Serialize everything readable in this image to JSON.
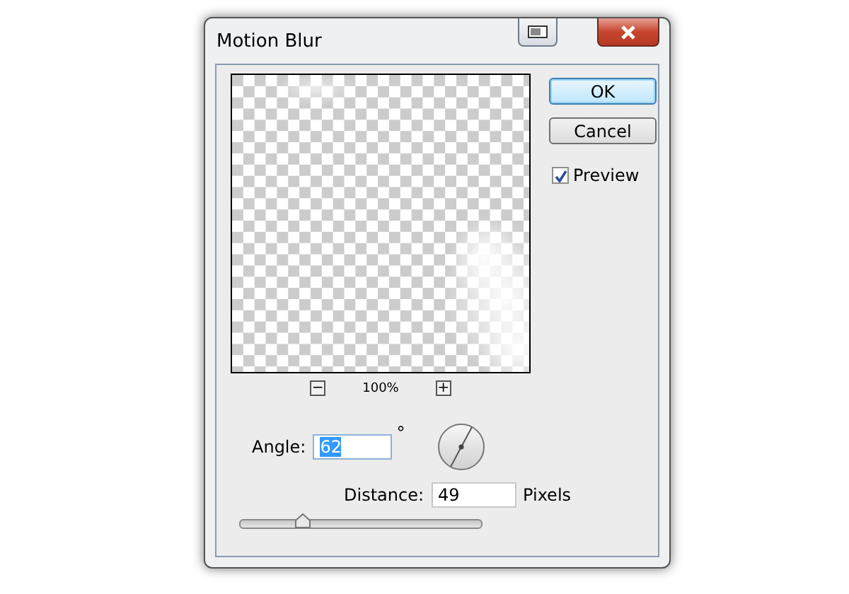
{
  "window": {
    "title": "Motion Blur"
  },
  "buttons": [
    {
      "label": "OK",
      "default": true
    },
    {
      "label": "Cancel",
      "default": false
    }
  ],
  "preview_checkbox": {
    "label": "Preview",
    "checked": true
  },
  "zoom": {
    "minus": "−",
    "value": "100%",
    "plus": "+"
  },
  "angle": {
    "label": "Angle:",
    "value": "62",
    "value_selected": true,
    "unit": "°"
  },
  "distance": {
    "label": "Distance:",
    "value": "49",
    "unit": "Pixels",
    "level": 0.26
  }
}
